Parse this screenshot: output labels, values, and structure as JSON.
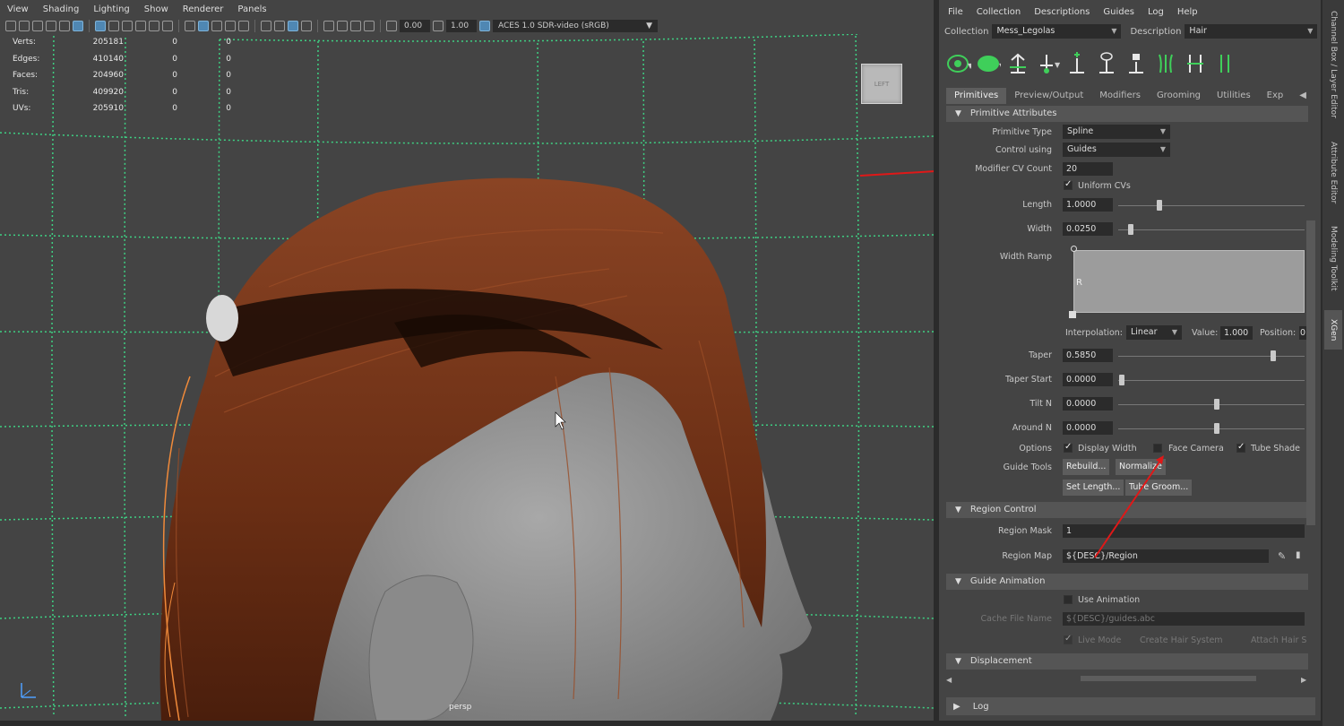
{
  "viewport": {
    "menu": [
      "View",
      "Shading",
      "Lighting",
      "Show",
      "Renderer",
      "Panels"
    ],
    "toolbar": {
      "field1": "0.00",
      "field2": "1.00",
      "colorspace": "ACES 1.0 SDR-video (sRGB)"
    },
    "hud": [
      {
        "label": "Verts:",
        "v1": "205181",
        "v2": "0",
        "v3": "0"
      },
      {
        "label": "Edges:",
        "v1": "410140",
        "v2": "0",
        "v3": "0"
      },
      {
        "label": "Faces:",
        "v1": "204960",
        "v2": "0",
        "v3": "0"
      },
      {
        "label": "Tris:",
        "v1": "409920",
        "v2": "0",
        "v3": "0"
      },
      {
        "label": "UVs:",
        "v1": "205910",
        "v2": "0",
        "v3": "0"
      }
    ],
    "viewcube_label": "LEFT",
    "camera": "persp"
  },
  "panel": {
    "menu": [
      "File",
      "Collection",
      "Descriptions",
      "Guides",
      "Log",
      "Help"
    ],
    "collection_label": "Collection",
    "collection_value": "Mess_Legolas",
    "description_label": "Description",
    "description_value": "Hair",
    "tabs": [
      "Primitives",
      "Preview/Output",
      "Modifiers",
      "Grooming",
      "Utilities",
      "Exp"
    ],
    "primitive_attributes": {
      "title": "Primitive Attributes",
      "primitive_type_label": "Primitive Type",
      "primitive_type": "Spline",
      "control_using_label": "Control using",
      "control_using": "Guides",
      "modifier_cv_count_label": "Modifier CV Count",
      "modifier_cv_count": "20",
      "uniform_cvs": "Uniform CVs",
      "length_label": "Length",
      "length": "1.0000",
      "width_label": "Width",
      "width": "0.0250",
      "width_ramp_label": "Width Ramp",
      "ramp_r": "R",
      "interpolation_label": "Interpolation:",
      "interpolation": "Linear",
      "value_label": "Value:",
      "value": "1.000",
      "position_label": "Position:",
      "position": "0",
      "taper_label": "Taper",
      "taper": "0.5850",
      "taper_start_label": "Taper Start",
      "taper_start": "0.0000",
      "tilt_n_label": "Tilt N",
      "tilt_n": "0.0000",
      "around_n_label": "Around N",
      "around_n": "0.0000",
      "options_label": "Options",
      "display_width": "Display Width",
      "face_camera": "Face Camera",
      "tube_shade": "Tube Shade",
      "guide_tools_label": "Guide Tools",
      "rebuild": "Rebuild...",
      "normalize": "Normalize",
      "set_length": "Set Length...",
      "tube_groom": "Tube Groom..."
    },
    "region_control": {
      "title": "Region Control",
      "region_mask_label": "Region Mask",
      "region_mask": "1",
      "region_map_label": "Region Map",
      "region_map": "${DESC}/Region"
    },
    "guide_animation": {
      "title": "Guide Animation",
      "use_animation": "Use Animation",
      "cache_file_label": "Cache File Name",
      "cache_file": "${DESC}/guides.abc",
      "live_mode": "Live Mode",
      "create_hair_system": "Create Hair System",
      "attach_hair": "Attach Hair S"
    },
    "displacement_title": "Displacement",
    "log_title": "Log"
  },
  "side_tabs": [
    "Channel Box / Layer Editor",
    "Attribute Editor",
    "Modeling Toolkit",
    "XGen"
  ],
  "colors": {
    "accent_blue": "#4f87b3",
    "grid_green": "#3ee08a",
    "annotation_red": "#e01818",
    "hair": "#7a3a1c"
  }
}
